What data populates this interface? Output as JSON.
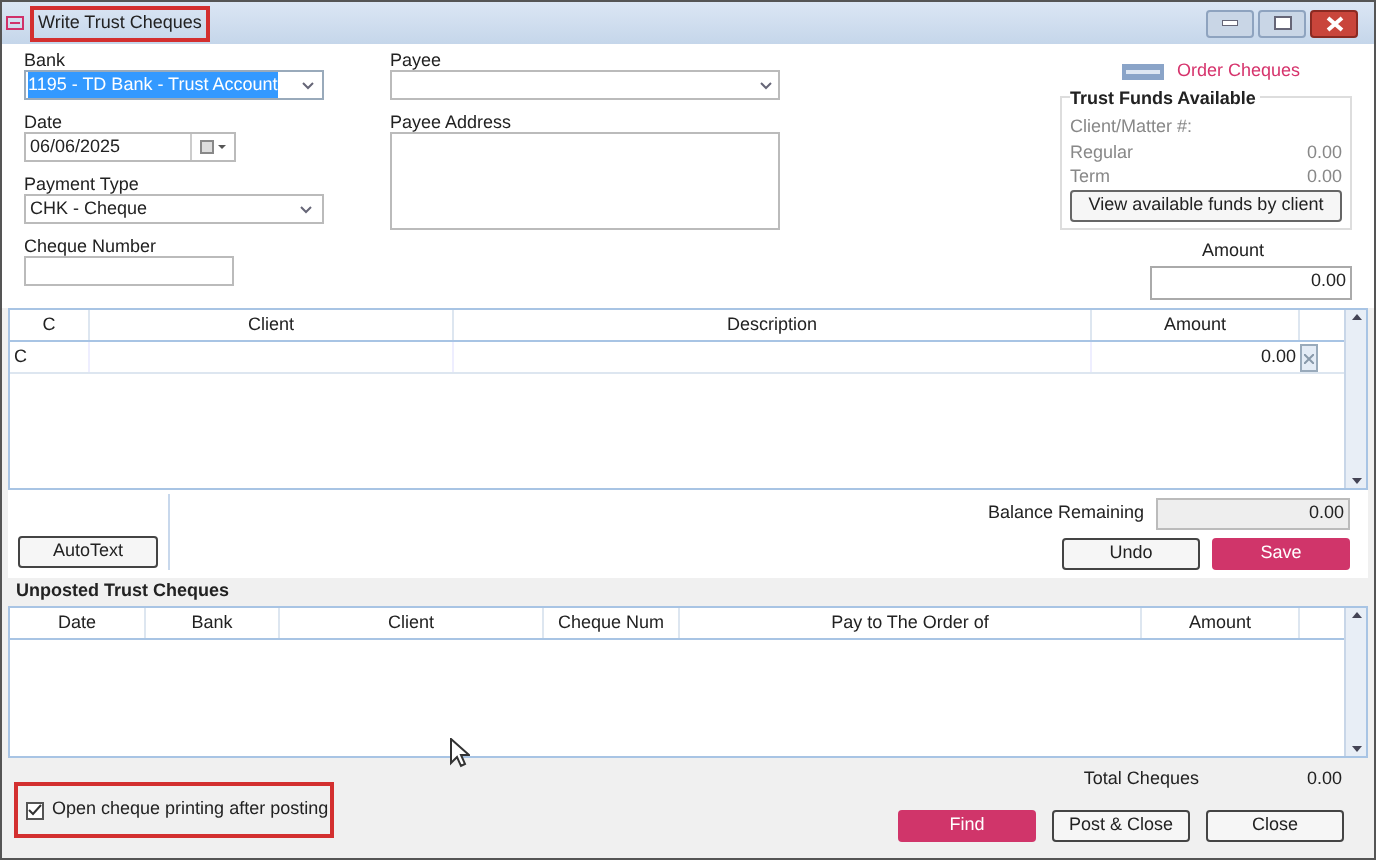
{
  "window": {
    "title": "Write Trust Cheques"
  },
  "form": {
    "bank": {
      "label": "Bank",
      "value": "1195 - TD Bank - Trust Account",
      "text_selected": true
    },
    "date": {
      "label": "Date",
      "value": "06/06/2025"
    },
    "payment_type": {
      "label": "Payment Type",
      "value": "CHK - Cheque"
    },
    "cheque_number": {
      "label": "Cheque Number"
    },
    "payee": {
      "label": "Payee"
    },
    "payee_address": {
      "label": "Payee Address"
    }
  },
  "order_cheques": "Order Cheques",
  "trust_funds": {
    "title": "Trust Funds Available",
    "client_matter_label": "Client/Matter #:",
    "rows": [
      {
        "label": "Regular",
        "value": "0.00"
      },
      {
        "label": "Term",
        "value": "0.00"
      }
    ],
    "button": "View available funds by client"
  },
  "amount": {
    "label": "Amount",
    "value": "0.00"
  },
  "entry_table": {
    "columns": [
      "C",
      "Client",
      "Description",
      "Amount"
    ],
    "rows": [
      {
        "c": "C",
        "amount": "0.00"
      }
    ]
  },
  "autotext_button": "AutoText",
  "balance_remaining": {
    "label": "Balance Remaining",
    "value": "0.00"
  },
  "undo_button": "Undo",
  "save_button": "Save",
  "unposted": {
    "title": "Unposted Trust Cheques",
    "columns": [
      "Date",
      "Bank",
      "Client",
      "Cheque Num",
      "Pay to The Order of",
      "Amount"
    ]
  },
  "total_cheques": {
    "label": "Total Cheques",
    "value": "0.00"
  },
  "open_printing": {
    "label": "Open cheque printing after posting",
    "checked": true
  },
  "buttons": [
    {
      "label": "Find",
      "kind": "primary"
    },
    {
      "label": "Post & Close",
      "kind": "normal"
    },
    {
      "label": "Close",
      "kind": "normal"
    }
  ]
}
